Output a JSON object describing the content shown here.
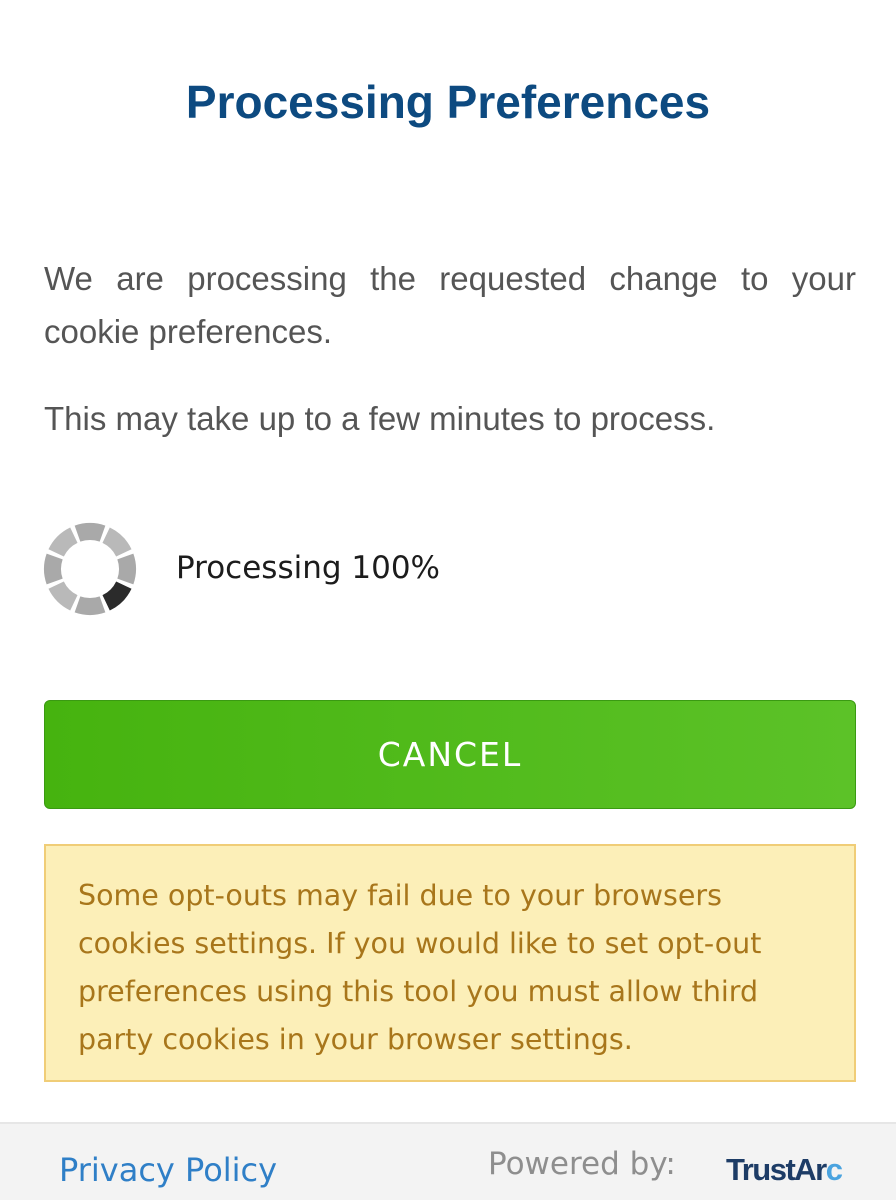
{
  "title": "Processing Preferences",
  "intro": "We are processing the requested change to your cookie preferences.",
  "time_notice": "This may take up to a few minutes to process.",
  "progress": {
    "label": "Processing 100%",
    "percent": 100,
    "icon": "spinner-icon"
  },
  "cancel_label": "CANCEL",
  "warning": "Some opt-outs may fail due to your browsers cookies settings. If you would like to set opt-out preferences using this tool you must allow third party cookies in your browser settings.",
  "footer": {
    "privacy_link": "Privacy Policy",
    "powered_by": "Powered by:",
    "logo": {
      "main": "TrustAr",
      "accent": "c"
    }
  },
  "colors": {
    "title": "#0d4a80",
    "button": "#52bb1e",
    "warning_background": "#fcefb8",
    "warning_text": "#a8761b",
    "link": "#2f7fc7"
  }
}
